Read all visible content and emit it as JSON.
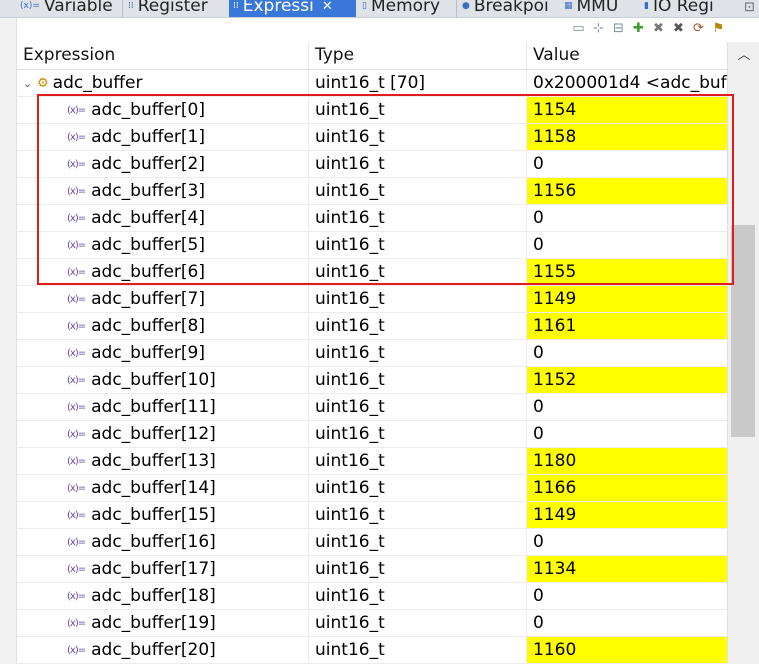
{
  "tabs": [
    {
      "label": "Variable",
      "icon": "variables-icon"
    },
    {
      "label": "Register",
      "icon": "registers-icon"
    },
    {
      "label": "Expressi",
      "icon": "expressions-icon",
      "active": true
    },
    {
      "label": "Memory",
      "icon": "memory-icon"
    },
    {
      "label": "Breakpoi",
      "icon": "breakpoints-icon"
    },
    {
      "label": "MMU",
      "icon": "mmu-icon"
    },
    {
      "label": "IO Regi",
      "icon": "io-registers-icon"
    }
  ],
  "table": {
    "headers": {
      "expression": "Expression",
      "type": "Type",
      "value": "Value"
    },
    "parent": {
      "expression": "adc_buffer",
      "type": "uint16_t [70]",
      "value": "0x200001d4 <adc_buf"
    },
    "rows": [
      {
        "expression": "adc_buffer[0]",
        "type": "uint16_t",
        "value": "1154",
        "changed": true
      },
      {
        "expression": "adc_buffer[1]",
        "type": "uint16_t",
        "value": "1158",
        "changed": true
      },
      {
        "expression": "adc_buffer[2]",
        "type": "uint16_t",
        "value": "0",
        "changed": false
      },
      {
        "expression": "adc_buffer[3]",
        "type": "uint16_t",
        "value": "1156",
        "changed": true
      },
      {
        "expression": "adc_buffer[4]",
        "type": "uint16_t",
        "value": "0",
        "changed": false
      },
      {
        "expression": "adc_buffer[5]",
        "type": "uint16_t",
        "value": "0",
        "changed": false
      },
      {
        "expression": "adc_buffer[6]",
        "type": "uint16_t",
        "value": "1155",
        "changed": true
      },
      {
        "expression": "adc_buffer[7]",
        "type": "uint16_t",
        "value": "1149",
        "changed": true
      },
      {
        "expression": "adc_buffer[8]",
        "type": "uint16_t",
        "value": "1161",
        "changed": true
      },
      {
        "expression": "adc_buffer[9]",
        "type": "uint16_t",
        "value": "0",
        "changed": false
      },
      {
        "expression": "adc_buffer[10]",
        "type": "uint16_t",
        "value": "1152",
        "changed": true
      },
      {
        "expression": "adc_buffer[11]",
        "type": "uint16_t",
        "value": "0",
        "changed": false
      },
      {
        "expression": "adc_buffer[12]",
        "type": "uint16_t",
        "value": "0",
        "changed": false
      },
      {
        "expression": "adc_buffer[13]",
        "type": "uint16_t",
        "value": "1180",
        "changed": true
      },
      {
        "expression": "adc_buffer[14]",
        "type": "uint16_t",
        "value": "1166",
        "changed": true
      },
      {
        "expression": "adc_buffer[15]",
        "type": "uint16_t",
        "value": "1149",
        "changed": true
      },
      {
        "expression": "adc_buffer[16]",
        "type": "uint16_t",
        "value": "0",
        "changed": false
      },
      {
        "expression": "adc_buffer[17]",
        "type": "uint16_t",
        "value": "1134",
        "changed": true
      },
      {
        "expression": "adc_buffer[18]",
        "type": "uint16_t",
        "value": "0",
        "changed": false
      },
      {
        "expression": "adc_buffer[19]",
        "type": "uint16_t",
        "value": "0",
        "changed": false
      },
      {
        "expression": "adc_buffer[20]",
        "type": "uint16_t",
        "value": "1160",
        "changed": true
      }
    ]
  },
  "colors": {
    "changed_highlight": "#ffff00",
    "active_tab": "#3978d9",
    "annotation_box": "#e21c1c"
  }
}
